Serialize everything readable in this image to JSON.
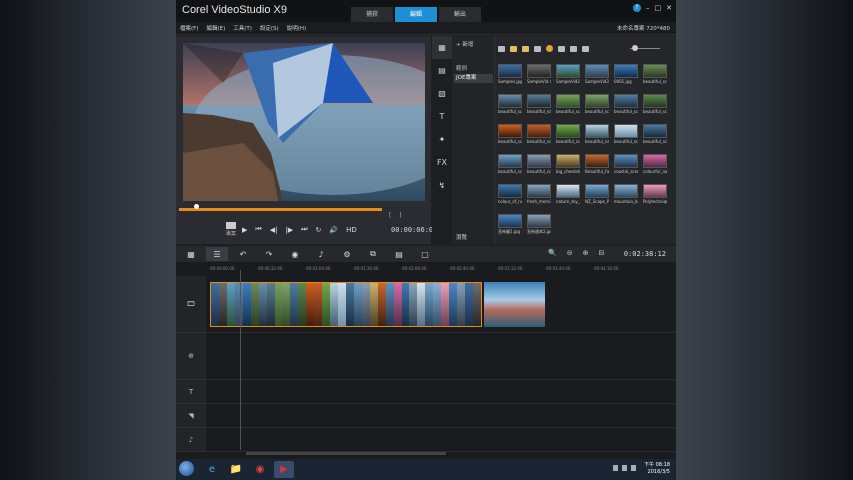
{
  "app": {
    "title": "Corel VideoStudio X9",
    "steps": [
      "捕获",
      "編輯",
      "輸出"
    ],
    "active_step": "編輯",
    "win_controls": [
      "?",
      "–",
      "□",
      "✕"
    ]
  },
  "menubar": {
    "items": [
      "檔案(F)",
      "編輯(E)",
      "工具(T)",
      "設定(S)",
      "說明(H)"
    ],
    "project_info": "未命名專案 720*480"
  },
  "player": {
    "mode_label": "專案",
    "transport": [
      "▶",
      "⏮",
      "◀|",
      "|▶",
      "⏭",
      "↻",
      "🔊",
      "HD"
    ],
    "timecode": "00:00:06:00",
    "trim_markers": [
      "[",
      "]"
    ],
    "progress_fraction": 1.0
  },
  "library": {
    "tab_icons": [
      "media-icon",
      "instant-project-icon",
      "transition-icon",
      "title-icon",
      "graphic-icon",
      "fx-icon",
      "path-icon"
    ],
    "tab_glyphs": [
      "▦",
      "▤",
      "▧",
      "T",
      "✦",
      "FX",
      "↯"
    ],
    "add_label": "+ 新增",
    "folders": [
      "範例",
      "JOE專案"
    ],
    "browse_label": "瀏覽",
    "thumbnails": [
      {
        "caption": "Samples.jpg",
        "c1": "#3b6fa4",
        "c2": "#1c2a44"
      },
      {
        "caption": "SampleVid.mp4",
        "c1": "#6d6d6d",
        "c2": "#222"
      },
      {
        "caption": "SampleVid2.mp4",
        "c1": "#5aa0c8",
        "c2": "#2a4d2f"
      },
      {
        "caption": "SampleVid3.mp4",
        "c1": "#5b8bb8",
        "c2": "#304050"
      },
      {
        "caption": "0001.jpg",
        "c1": "#3c7fc2",
        "c2": "#0d2c4d"
      },
      {
        "caption": "beautiful_scen...",
        "c1": "#6d8a5a",
        "c2": "#2a3a22"
      },
      {
        "caption": "beautiful_scen...",
        "c1": "#6a8fae",
        "c2": "#1d2b38"
      },
      {
        "caption": "beautiful_natu...",
        "c1": "#5a7e96",
        "c2": "#1b2631"
      },
      {
        "caption": "beautiful_scen...",
        "c1": "#76a25c",
        "c2": "#33502a"
      },
      {
        "caption": "beautiful_scen...",
        "c1": "#7fa36b",
        "c2": "#2f4326"
      },
      {
        "caption": "beautiful_scen...",
        "c1": "#4f7da3",
        "c2": "#1d3043"
      },
      {
        "caption": "beautiful_scen...",
        "c1": "#5b8850",
        "c2": "#25351e"
      },
      {
        "caption": "beautiful_scen...",
        "c1": "#d25f1f",
        "c2": "#3a1a0a"
      },
      {
        "caption": "beautiful_scen...",
        "c1": "#c65d2a",
        "c2": "#441f12"
      },
      {
        "caption": "beautiful_scen...",
        "c1": "#72a84b",
        "c2": "#2a4a1b"
      },
      {
        "caption": "beautiful_natu...",
        "c1": "#b8d3e0",
        "c2": "#3c5b6c"
      },
      {
        "caption": "beautiful_scen...",
        "c1": "#cfe0ee",
        "c2": "#6f8fa8"
      },
      {
        "caption": "beautiful_scen...",
        "c1": "#4b77a3",
        "c2": "#182a3c"
      },
      {
        "caption": "beautiful_scen...",
        "c1": "#6fa0c4",
        "c2": "#223a4e"
      },
      {
        "caption": "beautiful_scen...",
        "c1": "#8a9db2",
        "c2": "#313c48"
      },
      {
        "caption": "big_cheetah_sc...",
        "c1": "#cfb06b",
        "c2": "#4a3a1f"
      },
      {
        "caption": "Beautiful_Fall_f...",
        "c1": "#c46a30",
        "c2": "#3b1e0e"
      },
      {
        "caption": "coastal_scene...",
        "c1": "#5d8fbf",
        "c2": "#1f3348"
      },
      {
        "caption": "colourful_nature...",
        "c1": "#d76aa8",
        "c2": "#4f2944"
      },
      {
        "caption": "colour_of_north...",
        "c1": "#3f79b0",
        "c2": "#132a40"
      },
      {
        "caption": "fresh_mornin...",
        "c1": "#8aa6c0",
        "c2": "#2b3848"
      },
      {
        "caption": "nature_sky_p...",
        "c1": "#d8e4ec",
        "c2": "#4e6b82"
      },
      {
        "caption": "NZ_Scape_Pl...",
        "c1": "#7aa8d2",
        "c2": "#23405a"
      },
      {
        "caption": "mountain_bd...",
        "c1": "#8bb3d8",
        "c2": "#2d4a63"
      },
      {
        "caption": "Polytechnique...",
        "c1": "#e8a0b8",
        "c2": "#6a3a4a"
      },
      {
        "caption": "宣佈圖1.jpg",
        "c1": "#4d86c6",
        "c2": "#1b3350"
      },
      {
        "caption": "宣佈連串2.jpg",
        "c1": "#8aa0b8",
        "c2": "#2e3a48"
      }
    ]
  },
  "timeline": {
    "toolbar_glyphs": [
      "▦",
      "☰",
      "↶",
      "↷",
      "◉",
      "♪",
      "⚙",
      "⧉",
      "▤",
      "▢"
    ],
    "toolbar_icons": [
      "storyboard-view-icon",
      "timeline-view-icon",
      "undo-icon",
      "redo-icon",
      "record-capture-icon",
      "sound-mixer-icon",
      "auto-music-icon",
      "motion-tracking-icon",
      "subtitle-editor-icon",
      "multi-camera-icon"
    ],
    "zoom_controls": [
      "🔍",
      "⊖",
      "⊕",
      "⊟"
    ],
    "timecode": "0:02:38:12",
    "ruler_ticks": [
      "00:00:00:00",
      "00:00:32:00",
      "00:01:04:00",
      "00:01:36:00",
      "00:02:08:00",
      "00:02:40:00",
      "00:03:12:00",
      "00:03:44:00",
      "00:04:16:00"
    ],
    "track_labels": [
      "🎞",
      "⊕",
      "T",
      "◥",
      "♪"
    ],
    "track_icons": [
      "video-track-icon",
      "overlay-track-icon",
      "title-track-icon",
      "voice-track-icon",
      "music-track-icon"
    ]
  },
  "taskbar": {
    "apps": [
      "e",
      "📁",
      "◉",
      "▶"
    ],
    "app_icons": [
      "ie-icon",
      "explorer-icon",
      "chrome-icon",
      "videostudio-icon"
    ],
    "time": "下午 08:18",
    "date": "2016/3/5"
  }
}
